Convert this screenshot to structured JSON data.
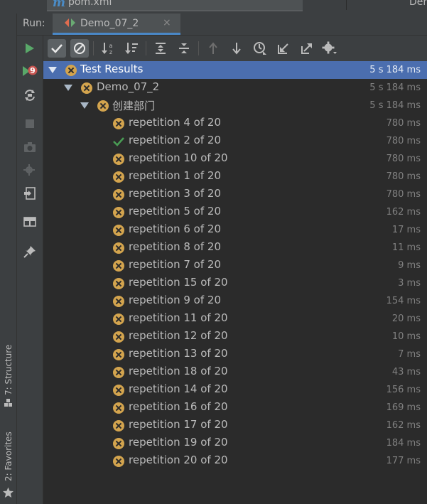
{
  "editor_tabs": {
    "file_name": "pom.xml",
    "right_tab_text": "Der"
  },
  "run_panel": {
    "label": "Run:",
    "tab_name": "Demo_07_2",
    "tab_close": "×"
  },
  "left_strip": {
    "structure_tab": "7: Structure",
    "favorites_tab": "2: Favorites"
  },
  "sidebar_icons": [
    "run-icon",
    "rerun-failed-icon",
    "toggle-auto-test-icon",
    "stop-icon",
    "dump-threads-icon",
    "settings-icon",
    "exit-icon",
    "layout-icon",
    "pin-icon"
  ],
  "toolbar_icons": [
    "show-passed-icon",
    "show-ignored-icon",
    "sort-alphabetically-icon",
    "sort-by-duration-icon",
    "expand-all-icon",
    "collapse-all-icon",
    "previous-failed-icon",
    "next-failed-icon",
    "test-history-icon",
    "import-tests-icon",
    "export-tests-icon",
    "settings-gear-icon"
  ],
  "colors": {
    "fail": "#d3a44e",
    "pass": "#499c54",
    "selected": "#4b6eaf",
    "accent": "#4a88c7"
  },
  "tree": {
    "root": {
      "label": "Test Results",
      "time": "5 s 184 ms",
      "status": "failed"
    },
    "class_node": {
      "label": "Demo_07_2",
      "time": "5 s 184 ms",
      "status": "failed"
    },
    "method_node": {
      "label": "创建部门",
      "time": "5 s 184 ms",
      "status": "failed"
    },
    "items": [
      {
        "label": "repetition 4 of 20",
        "time": "780 ms",
        "status": "failed"
      },
      {
        "label": "repetition 2 of 20",
        "time": "780 ms",
        "status": "passed"
      },
      {
        "label": "repetition 10 of 20",
        "time": "780 ms",
        "status": "failed"
      },
      {
        "label": "repetition 1 of 20",
        "time": "780 ms",
        "status": "failed"
      },
      {
        "label": "repetition 3 of 20",
        "time": "780 ms",
        "status": "failed"
      },
      {
        "label": "repetition 5 of 20",
        "time": "162 ms",
        "status": "failed"
      },
      {
        "label": "repetition 6 of 20",
        "time": "17 ms",
        "status": "failed"
      },
      {
        "label": "repetition 8 of 20",
        "time": "11 ms",
        "status": "failed"
      },
      {
        "label": "repetition 7 of 20",
        "time": "9 ms",
        "status": "failed"
      },
      {
        "label": "repetition 15 of 20",
        "time": "3 ms",
        "status": "failed"
      },
      {
        "label": "repetition 9 of 20",
        "time": "154 ms",
        "status": "failed"
      },
      {
        "label": "repetition 11 of 20",
        "time": "20 ms",
        "status": "failed"
      },
      {
        "label": "repetition 12 of 20",
        "time": "10 ms",
        "status": "failed"
      },
      {
        "label": "repetition 13 of 20",
        "time": "7 ms",
        "status": "failed"
      },
      {
        "label": "repetition 18 of 20",
        "time": "43 ms",
        "status": "failed"
      },
      {
        "label": "repetition 14 of 20",
        "time": "156 ms",
        "status": "failed"
      },
      {
        "label": "repetition 16 of 20",
        "time": "169 ms",
        "status": "failed"
      },
      {
        "label": "repetition 17 of 20",
        "time": "162 ms",
        "status": "failed"
      },
      {
        "label": "repetition 19 of 20",
        "time": "184 ms",
        "status": "failed"
      },
      {
        "label": "repetition 20 of 20",
        "time": "177 ms",
        "status": "failed"
      }
    ]
  }
}
